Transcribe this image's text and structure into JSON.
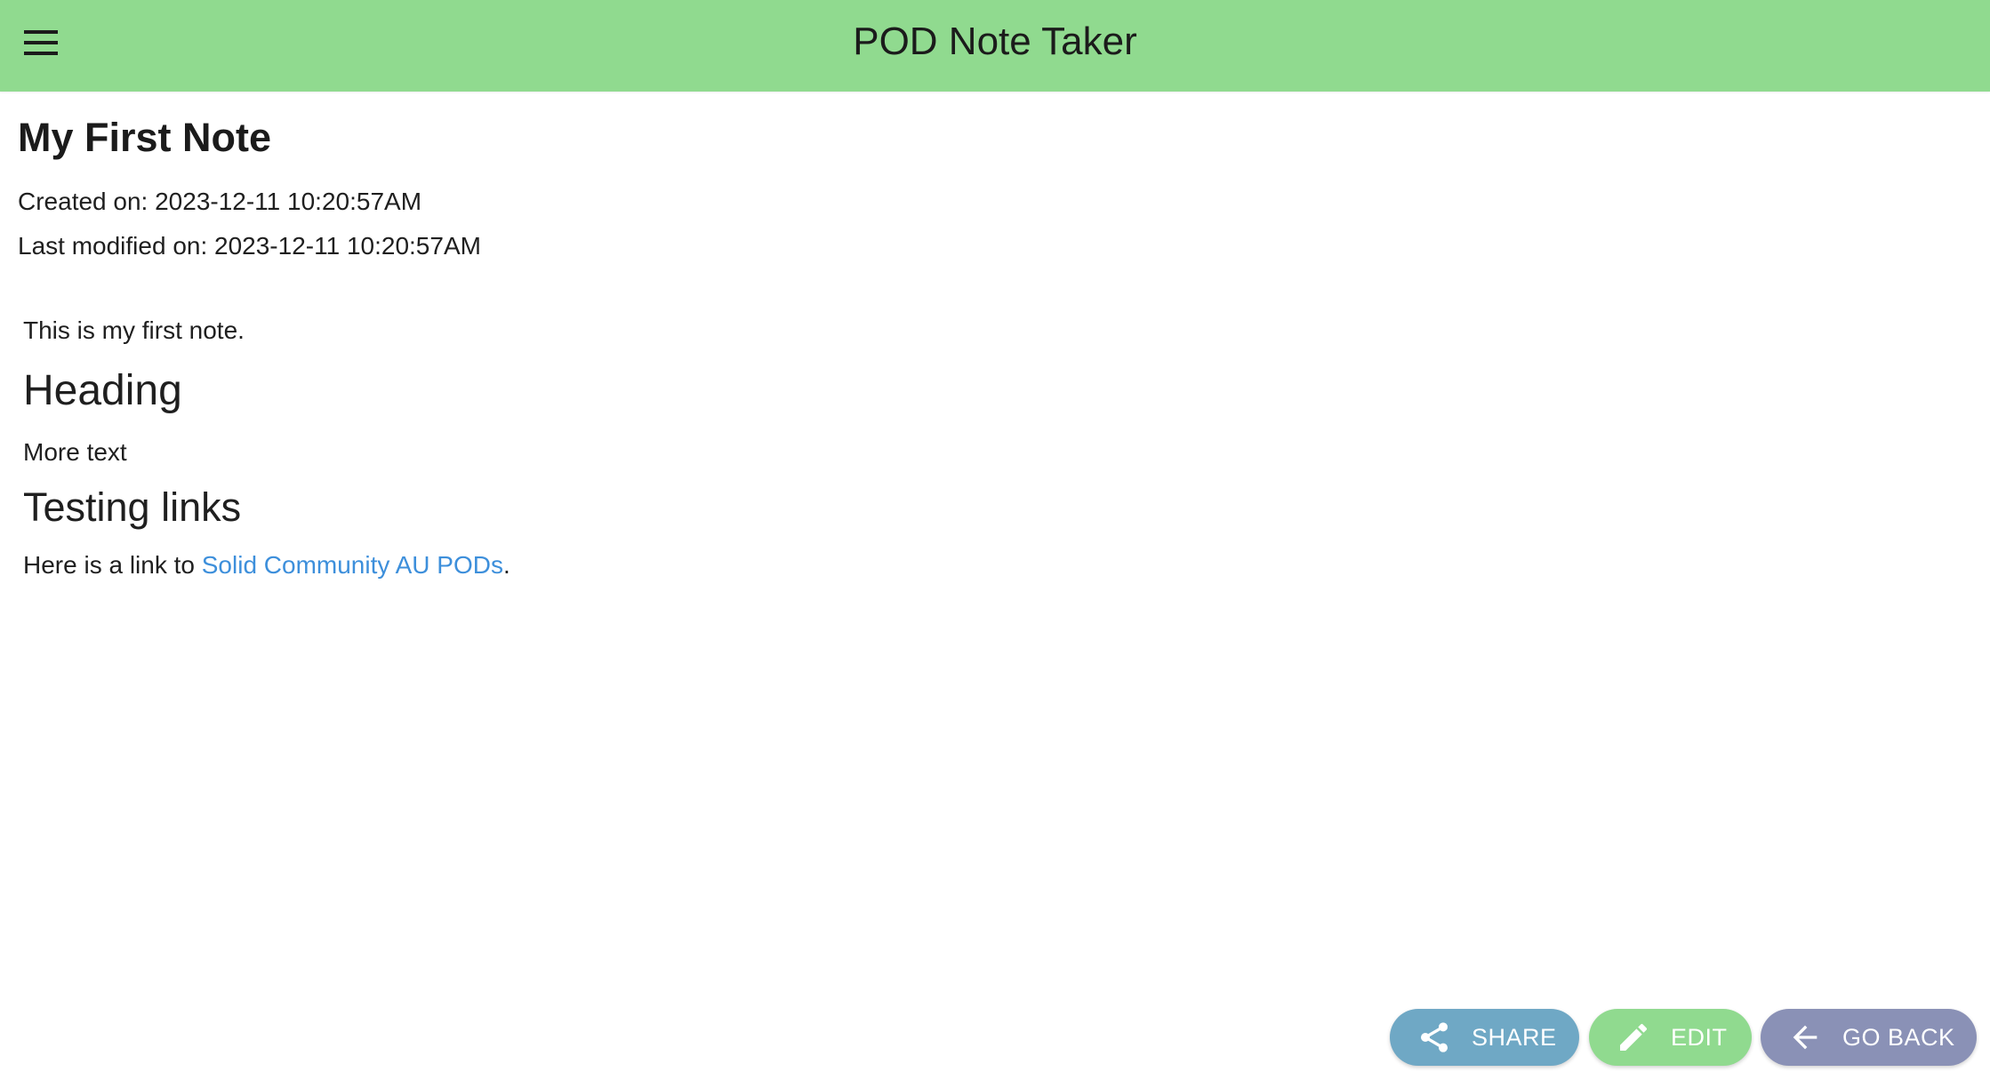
{
  "header": {
    "title": "POD Note Taker",
    "menu_icon": "menu-icon",
    "background": "#90da8f"
  },
  "note": {
    "title": "My First Note",
    "created": "Created on: 2023-12-11 10:20:57AM",
    "modified": "Last modified on: 2023-12-11 10:20:57AM",
    "content": {
      "paragraph1": "This is my first note.",
      "heading1": "Heading",
      "paragraph2": "More text",
      "heading2": "Testing links",
      "link_prefix": "Here is a link to ",
      "link_text": "Solid Community AU PODs",
      "link_suffix": "."
    }
  },
  "actions": {
    "share": {
      "label": "SHARE",
      "icon": "share-icon",
      "color": "#6fa8c5"
    },
    "edit": {
      "label": "EDIT",
      "icon": "pencil-icon",
      "color": "#90da8f"
    },
    "back": {
      "label": "GO BACK",
      "icon": "arrow-left-icon",
      "color": "#8a91b6"
    }
  },
  "colors": {
    "link": "#3d8fdb",
    "text": "#1f1f1f"
  }
}
